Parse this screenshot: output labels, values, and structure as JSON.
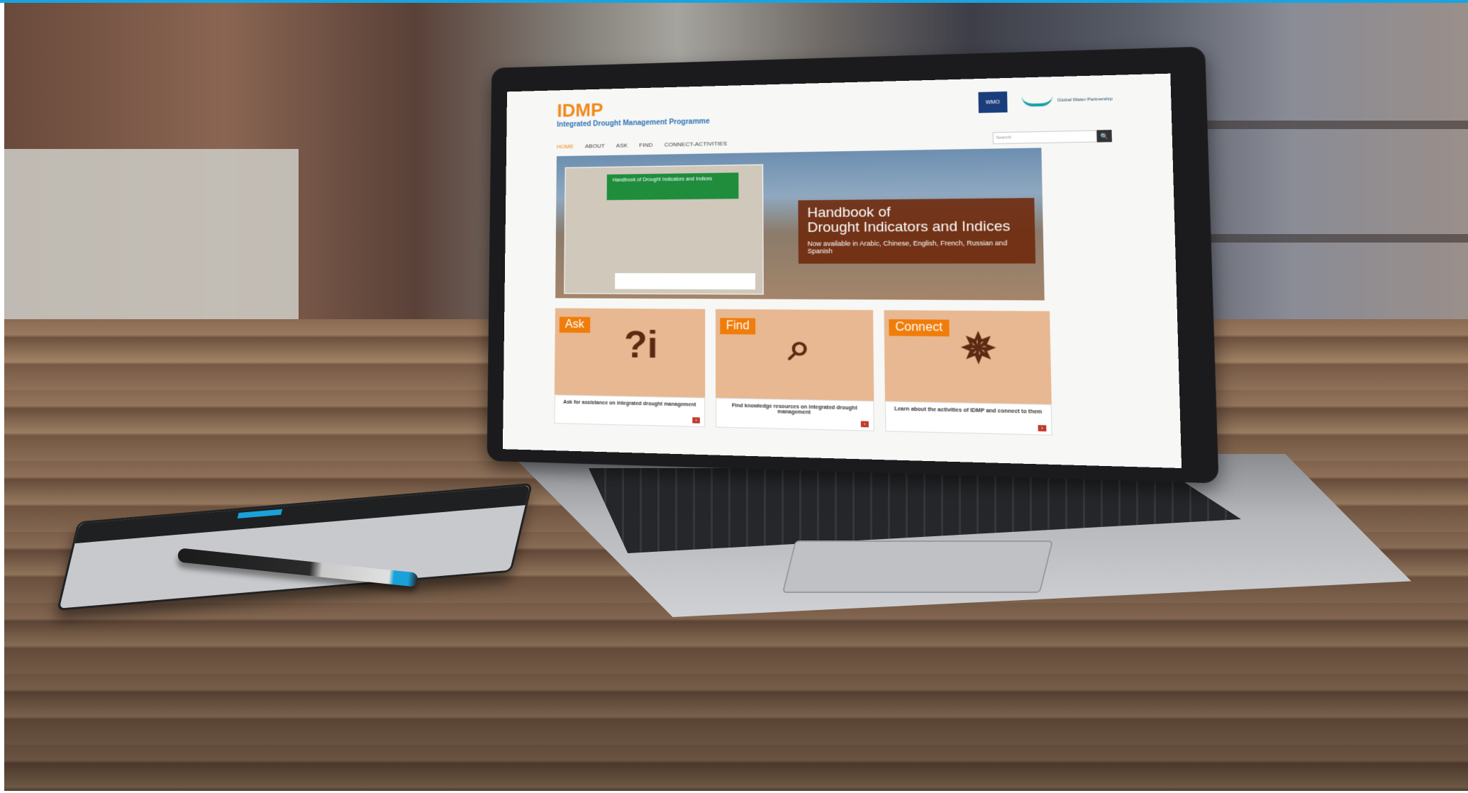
{
  "site": {
    "logo": "IDMP",
    "logo_subtitle": "Integrated Drought Management Programme",
    "partners": {
      "wmo_label": "WMO",
      "gwp_label": "Global Water Partnership"
    }
  },
  "nav": {
    "items": [
      "HOME",
      "ABOUT",
      "ASK",
      "FIND",
      "CONNECT-ACTIVITIES"
    ],
    "active": "HOME"
  },
  "search": {
    "placeholder": "Search",
    "button_icon": "search-icon"
  },
  "hero": {
    "book_title": "Handbook of Drought Indicators and Indices",
    "title_line1": "Handbook of",
    "title_line2": "Drought Indicators and Indices",
    "subtitle": "Now available in Arabic, Chinese, English, French, Russian and Spanish"
  },
  "cards": [
    {
      "tag": "Ask",
      "icon": "question-info-icon",
      "text": "Ask for assistance on integrated drought management"
    },
    {
      "tag": "Find",
      "icon": "magnifier-icon",
      "text": "Find knowledge resources on integrated drought management"
    },
    {
      "tag": "Connect",
      "icon": "connect-people-icon",
      "text": "Learn about the activities of IDMP and connect to them"
    }
  ],
  "colors": {
    "accent_orange": "#f08a1c",
    "brand_blue": "#2e74b5",
    "card_bg": "#e7b891",
    "hero_panel": "#6e280a"
  }
}
